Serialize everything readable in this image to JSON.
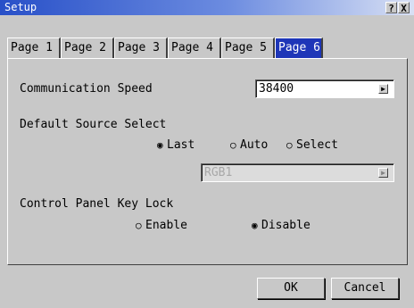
{
  "window": {
    "title": "Setup",
    "help_label": "?",
    "close_label": "X"
  },
  "tabs": [
    {
      "label": "Page 1"
    },
    {
      "label": "Page 2"
    },
    {
      "label": "Page 3"
    },
    {
      "label": "Page 4"
    },
    {
      "label": "Page 5"
    },
    {
      "label": "Page 6",
      "active": true
    }
  ],
  "communication_speed": {
    "label": "Communication Speed",
    "value": "38400"
  },
  "default_source": {
    "label": "Default Source Select",
    "options": [
      {
        "label": "Last",
        "selected": true
      },
      {
        "label": "Auto",
        "selected": false
      },
      {
        "label": "Select",
        "selected": false
      }
    ],
    "select_value": "RGB1"
  },
  "key_lock": {
    "label": "Control Panel Key Lock",
    "options": [
      {
        "label": "Enable",
        "selected": false
      },
      {
        "label": "Disable",
        "selected": true
      }
    ]
  },
  "buttons": {
    "ok": "OK",
    "cancel": "Cancel"
  },
  "icons": {
    "radio_on": "radio-selected-icon",
    "radio_off": "radio-unselected-icon",
    "dropdown": "dropdown-arrow-icon"
  }
}
